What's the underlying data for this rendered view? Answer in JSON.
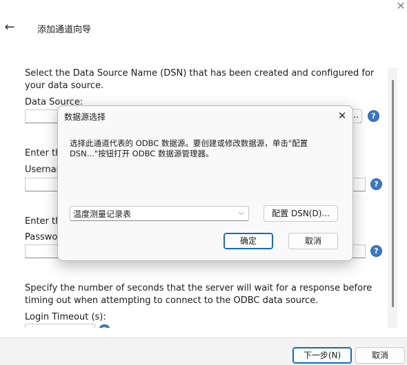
{
  "window": {
    "close_glyph": "✕"
  },
  "wizard": {
    "back_glyph": "←",
    "title": "添加通道向导"
  },
  "page": {
    "intro": "Select the Data Source Name (DSN) that has been created and configured for your data source.",
    "data_source_label": "Data Source:",
    "browse_label": "...",
    "enter_username_prefix": "Enter the",
    "username_prefix": "Usernam",
    "enter_password_prefix": "Enter the",
    "password_prefix": "Passwor",
    "timeout_text": "Specify the number of seconds that the server will wait for a response before timing out when attempting to connect to the ODBC data source.",
    "timeout_label": "Login Timeout (s):",
    "help_glyph": "?"
  },
  "footer": {
    "next_label": "下一步(N)",
    "cancel_label": "取消"
  },
  "dialog": {
    "title": "数据源选择",
    "close_glyph": "✕",
    "description": "选择此通道代表的 ODBC 数据源。要创建或修改数据源，单击\"配置 DSN...\"按钮打开 ODBC 数据源管理器。",
    "dsn_selected": "温度测量记录表",
    "dropdown_glyph": "⌵",
    "configure_label": "配置 DSN(D)...",
    "ok_label": "确定",
    "cancel_label": "取消"
  },
  "colors": {
    "accent": "#0f6cbd",
    "help_blue": "#3a78c8"
  }
}
